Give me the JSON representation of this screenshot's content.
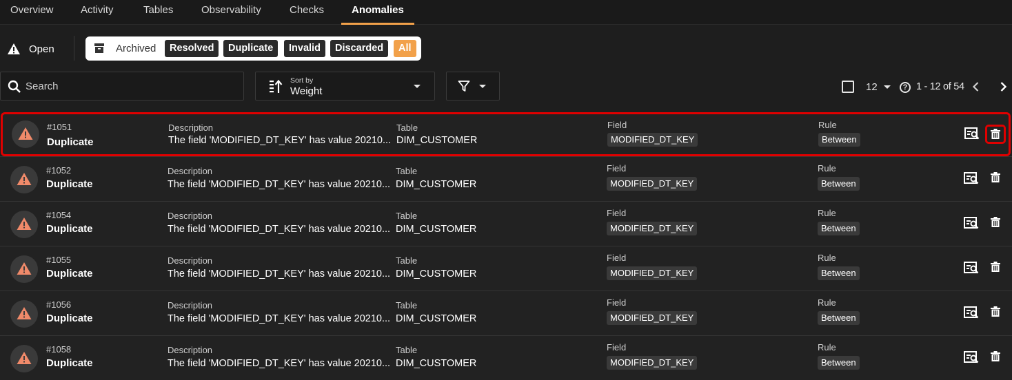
{
  "tabs": [
    "Overview",
    "Activity",
    "Tables",
    "Observability",
    "Checks",
    "Anomalies"
  ],
  "active_tab": "Anomalies",
  "status": {
    "open_label": "Open",
    "archived_label": "Archived",
    "chips": [
      "Resolved",
      "Duplicate",
      "Invalid",
      "Discarded",
      "All"
    ],
    "selected_chip": "All"
  },
  "search": {
    "placeholder": "Search"
  },
  "sort": {
    "caption": "Sort by",
    "value": "Weight"
  },
  "pagination": {
    "per_page": "12",
    "range": "1 - 12 of 54",
    "help": "?"
  },
  "columns": {
    "description": "Description",
    "table": "Table",
    "field": "Field",
    "rule": "Rule"
  },
  "rows": [
    {
      "id": "#1051",
      "type": "Duplicate",
      "description": "The field 'MODIFIED_DT_KEY' has value 20210...",
      "table": "DIM_CUSTOMER",
      "field": "MODIFIED_DT_KEY",
      "rule": "Between",
      "selected": true
    },
    {
      "id": "#1052",
      "type": "Duplicate",
      "description": "The field 'MODIFIED_DT_KEY' has value 20210...",
      "table": "DIM_CUSTOMER",
      "field": "MODIFIED_DT_KEY",
      "rule": "Between"
    },
    {
      "id": "#1054",
      "type": "Duplicate",
      "description": "The field 'MODIFIED_DT_KEY' has value 20210...",
      "table": "DIM_CUSTOMER",
      "field": "MODIFIED_DT_KEY",
      "rule": "Between"
    },
    {
      "id": "#1055",
      "type": "Duplicate",
      "description": "The field 'MODIFIED_DT_KEY' has value 20210...",
      "table": "DIM_CUSTOMER",
      "field": "MODIFIED_DT_KEY",
      "rule": "Between"
    },
    {
      "id": "#1056",
      "type": "Duplicate",
      "description": "The field 'MODIFIED_DT_KEY' has value 20210...",
      "table": "DIM_CUSTOMER",
      "field": "MODIFIED_DT_KEY",
      "rule": "Between"
    },
    {
      "id": "#1058",
      "type": "Duplicate",
      "description": "The field 'MODIFIED_DT_KEY' has value 20210...",
      "table": "DIM_CUSTOMER",
      "field": "MODIFIED_DT_KEY",
      "rule": "Between"
    }
  ],
  "colors": {
    "accent": "#f2a14a",
    "warning": "#f08a6a",
    "highlight": "#e00000"
  }
}
